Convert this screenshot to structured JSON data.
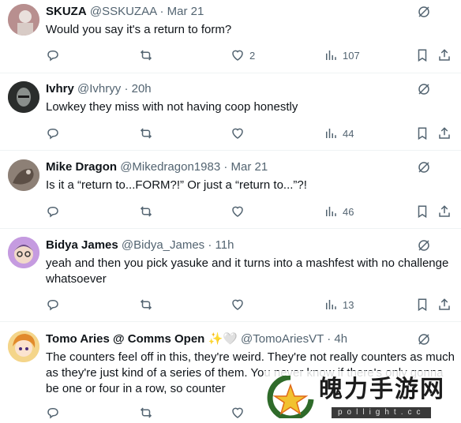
{
  "tweets": [
    {
      "name": "SKUZA",
      "handle": "@SSKUZAA",
      "time": "Mar 21",
      "text": "Would you say it's a return to form?",
      "likes": "2",
      "views": "107"
    },
    {
      "name": "Ivhry",
      "handle": "@Ivhryy",
      "time": "20h",
      "text": "Lowkey they miss with not having coop honestly",
      "likes": "",
      "views": "44"
    },
    {
      "name": "Mike Dragon",
      "handle": "@Mikedragon1983",
      "time": "Mar 21",
      "text": "Is it a “return to...FORM?!” Or just a “return to...”?!",
      "likes": "",
      "views": "46"
    },
    {
      "name": "Bidya James",
      "handle": "@Bidya_James",
      "time": "11h",
      "text": "yeah and then you pick yasuke and it turns into a mashfest with no challenge whatsoever",
      "likes": "",
      "views": "13"
    },
    {
      "name": "Tomo Aries @ Comms Open",
      "emoji": "✨🤍",
      "handle": "@TomoAriesVT",
      "time": "4h",
      "text": "The counters feel off in this, they're weird. They're not really counters as much as they're just kind of a series of them. You never know if there's only gonna be one or four in a row, so counter",
      "likes": "",
      "views": ""
    }
  ],
  "separator": "·",
  "watermark": {
    "title": "魄力手游网",
    "sub": "pollight.cc"
  },
  "colors": {
    "text": "#0f1419",
    "muted": "#536471",
    "divider": "#eff3f4"
  }
}
